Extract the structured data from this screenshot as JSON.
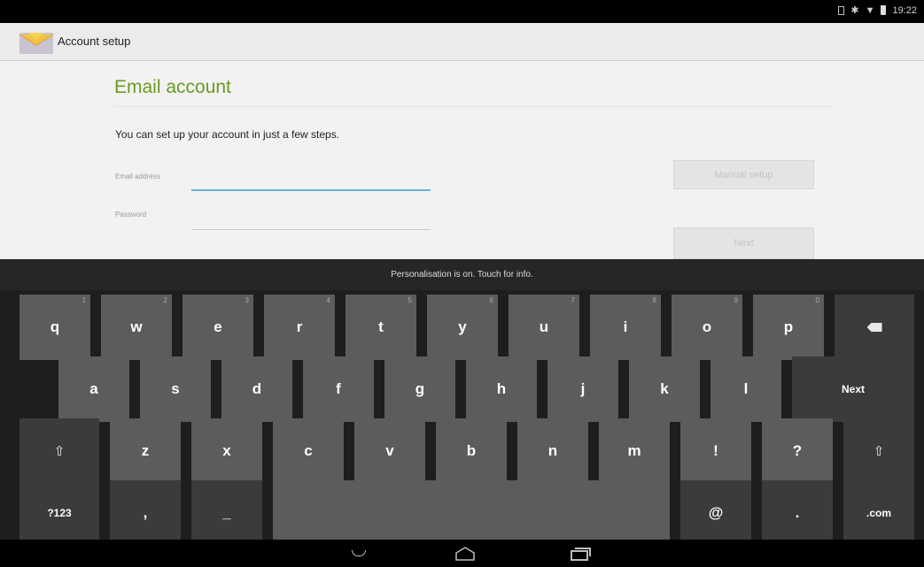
{
  "status_bar": {
    "time": "19:22",
    "icons": [
      "sim-icon",
      "bluetooth-icon",
      "wifi-icon",
      "battery-icon"
    ]
  },
  "action_bar": {
    "app_icon": "email-app-icon",
    "title": "Account setup"
  },
  "form": {
    "heading": "Email account",
    "intro": "You can set up your account in just a few steps.",
    "email_label": "Email address",
    "email_value": "",
    "password_label": "Password",
    "password_value": "",
    "manual_setup_label": "Manual setup",
    "next_label": "Next",
    "accent_color": "#6b9a23",
    "focus_color": "#6bb3cf"
  },
  "keyboard": {
    "hint_text": "Personalisation is on. Touch for info.",
    "row1": [
      {
        "label": "q",
        "hint": "1"
      },
      {
        "label": "w",
        "hint": "2"
      },
      {
        "label": "e",
        "hint": "3"
      },
      {
        "label": "r",
        "hint": "4"
      },
      {
        "label": "t",
        "hint": "5"
      },
      {
        "label": "y",
        "hint": "6"
      },
      {
        "label": "u",
        "hint": "7"
      },
      {
        "label": "i",
        "hint": "8"
      },
      {
        "label": "o",
        "hint": "9"
      },
      {
        "label": "p",
        "hint": "0"
      }
    ],
    "backspace": "backspace-icon",
    "row2": [
      "a",
      "s",
      "d",
      "f",
      "g",
      "h",
      "j",
      "k",
      "l"
    ],
    "action_label": "Next",
    "shift": "shift-icon",
    "row3": [
      "z",
      "x",
      "c",
      "v",
      "b",
      "n",
      "m",
      "!",
      "?"
    ],
    "symbols_label": "?123",
    "comma_label": ",",
    "dash_label": "_",
    "at_label": "@",
    "period_label": ".",
    "dotcom_label": ".com"
  },
  "nav_bar": {
    "buttons": [
      "hide-keyboard-icon",
      "home-icon",
      "recent-apps-icon"
    ]
  }
}
